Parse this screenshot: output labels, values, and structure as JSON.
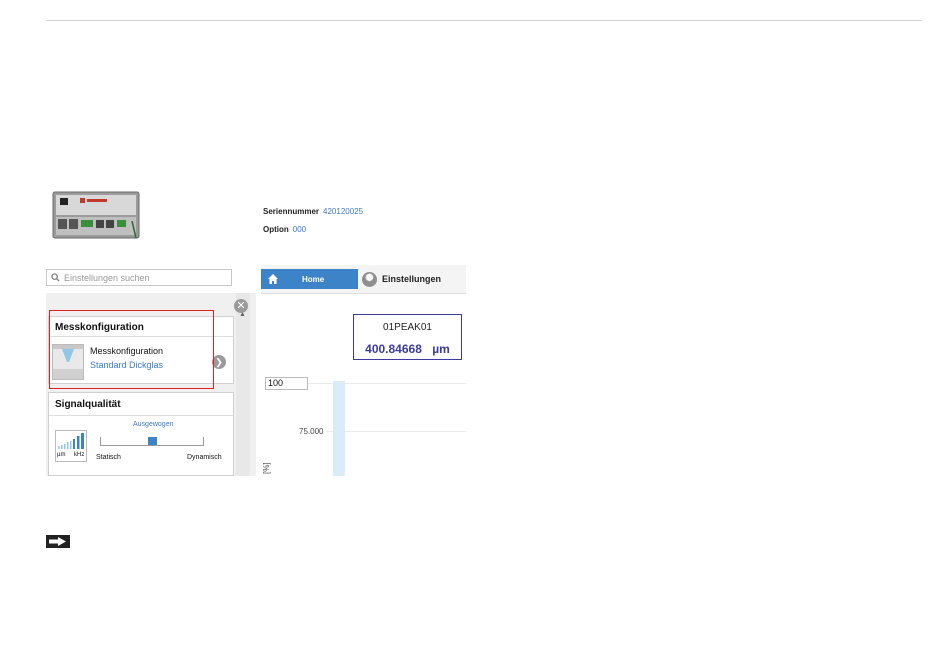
{
  "device_info": {
    "serial_label": "Seriennummer",
    "serial_value": "420120025",
    "option_label": "Option",
    "option_value": "000"
  },
  "screenshot": {
    "search_placeholder": "Einstellungen suchen",
    "tabs": [
      {
        "label": "Home",
        "icon": "home-icon",
        "active": true
      },
      {
        "label": "Einstellungen",
        "icon": "gear-icon",
        "active": false
      }
    ],
    "panels": [
      {
        "title": "Messkonfiguration",
        "item_label": "Messkonfiguration",
        "item_value": "Standard Dickglas"
      },
      {
        "title": "Signalqualität",
        "slider_value_label": "Ausgewogen",
        "slider_min_label": "Statisch",
        "slider_max_label": "Dynamisch",
        "thumb_label_left": "µm",
        "thumb_label_right": "kHz"
      }
    ],
    "measurement": {
      "name": "01PEAK01",
      "value": "400.84668",
      "unit": "µm"
    },
    "chart": {
      "y_max_input": "100",
      "y_tick": "75.000",
      "y_unit": "[%]"
    }
  },
  "colors": {
    "accent": "#3d83c8",
    "highlight_box": "#e0211d",
    "measure_value": "#3b3b9f"
  }
}
